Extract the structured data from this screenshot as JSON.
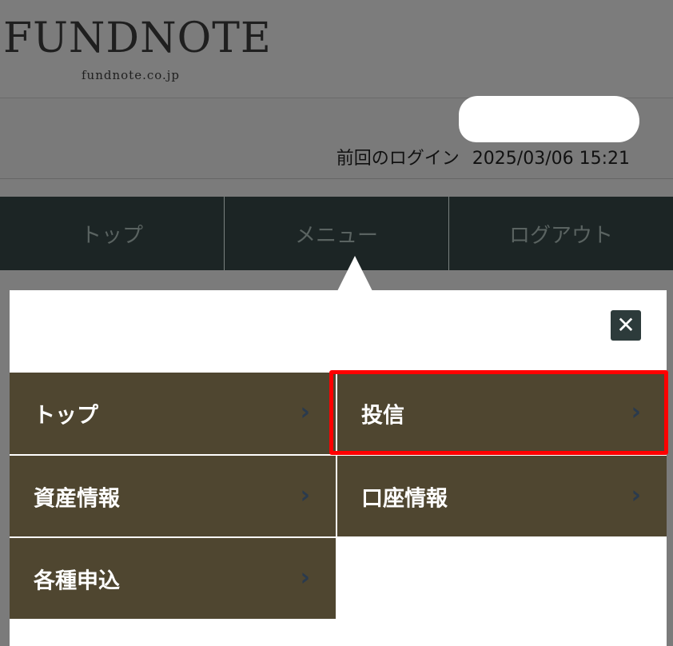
{
  "header": {
    "logo_wordmark": "FUNDNOTE",
    "logo_domain": "fundnote.co.jp"
  },
  "user_info": {
    "last_login_label": "前回のログイン",
    "last_login_value": "2025/03/06 15:21"
  },
  "nav": {
    "top": "トップ",
    "menu": "メニュー",
    "logout": "ログアウト"
  },
  "menu": {
    "close_icon": "close-icon",
    "items": [
      {
        "label": "トップ",
        "icon": "chevron-right-icon"
      },
      {
        "label": "投信",
        "icon": "chevron-right-icon"
      },
      {
        "label": "資産情報",
        "icon": "chevron-right-icon"
      },
      {
        "label": "口座情報",
        "icon": "chevron-right-icon"
      },
      {
        "label": "各種申込",
        "icon": "chevron-right-icon"
      }
    ]
  },
  "colors": {
    "tile_bg": "#4f4630",
    "nav_bg": "#1c2525",
    "highlight": "#ff0000",
    "close_bg": "#2d3b3b"
  }
}
